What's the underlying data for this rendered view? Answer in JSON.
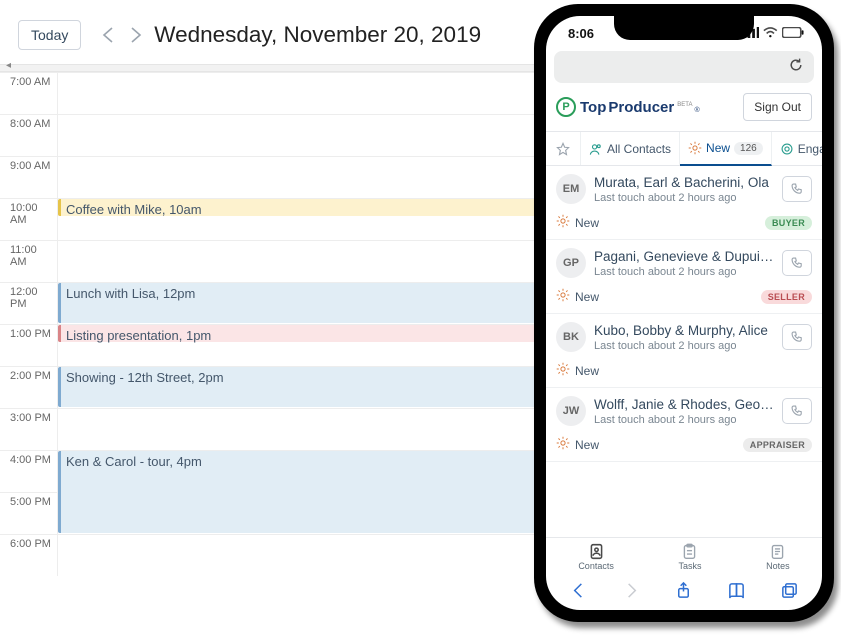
{
  "calendar": {
    "today_label": "Today",
    "title": "Wednesday, November 20, 2019",
    "hours": [
      "7:00 AM",
      "8:00 AM",
      "9:00 AM",
      "10:00 AM",
      "11:00 AM",
      "12:00 PM",
      "1:00 PM",
      "2:00 PM",
      "3:00 PM",
      "4:00 PM",
      "5:00 PM",
      "6:00 PM"
    ],
    "events": [
      {
        "label": "Coffee with Mike, 10am",
        "row": 3,
        "span": 0.45,
        "color": "yellow"
      },
      {
        "label": "Lunch with Lisa, 12pm",
        "row": 5,
        "span": 1,
        "color": "blue"
      },
      {
        "label": "Listing presentation, 1pm",
        "row": 6,
        "span": 0.45,
        "color": "red"
      },
      {
        "label": "Showing - 12th Street, 2pm",
        "row": 7,
        "span": 1,
        "color": "blue"
      },
      {
        "label": "Ken & Carol - tour, 4pm",
        "row": 9,
        "span": 2,
        "color": "blue"
      }
    ]
  },
  "phone": {
    "status_time": "8:06",
    "brand_prefix": "Top",
    "brand_suffix": "Producer",
    "brand_mark": "P",
    "brand_badge": "BETA",
    "brand_tm": "®",
    "signout_label": "Sign Out",
    "tabs": {
      "all_contacts": "All Contacts",
      "new": "New",
      "new_count": "126",
      "engage": "Engage"
    },
    "contacts": [
      {
        "initials": "EM",
        "name": "Murata, Earl & Bacherini, Ola",
        "sub": "Last touch about 2 hours ago",
        "status": "New",
        "pill": "BUYER",
        "pill_class": "buyer"
      },
      {
        "initials": "GP",
        "name": "Pagani, Genevieve & Dupuis...",
        "sub": "Last touch about 2 hours ago",
        "status": "New",
        "pill": "SELLER",
        "pill_class": "seller"
      },
      {
        "initials": "BK",
        "name": "Kubo, Bobby & Murphy, Alice",
        "sub": "Last touch about 2 hours ago",
        "status": "New",
        "pill": "",
        "pill_class": ""
      },
      {
        "initials": "JW",
        "name": "Wolff, Janie & Rhodes, George",
        "sub": "Last touch about 2 hours ago",
        "status": "New",
        "pill": "APPRAISER",
        "pill_class": "appraiser"
      }
    ],
    "bottom_tabs": {
      "contacts": "Contacts",
      "tasks": "Tasks",
      "notes": "Notes"
    }
  }
}
